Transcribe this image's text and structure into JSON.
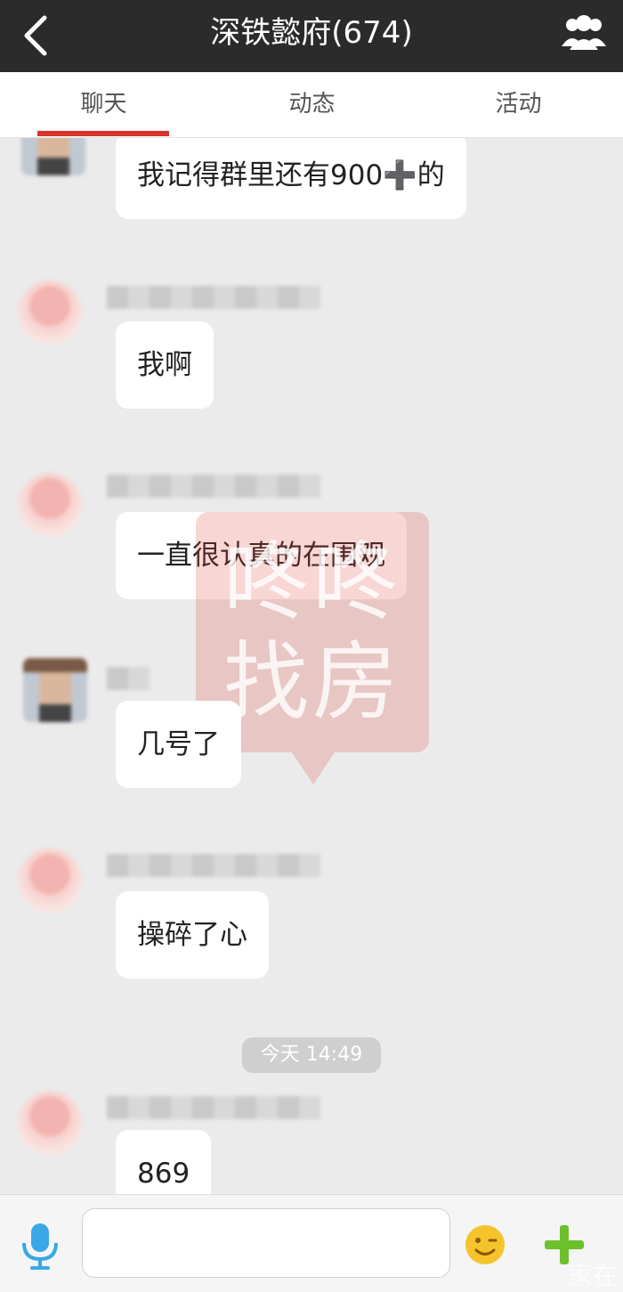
{
  "header": {
    "title": "深铁懿府(674)",
    "back_icon": "chevron-left-icon",
    "members_icon": "group-icon"
  },
  "tabs": [
    {
      "label": "聊天",
      "active": true
    },
    {
      "label": "动态",
      "active": false
    },
    {
      "label": "活动",
      "active": false
    }
  ],
  "messages": [
    {
      "text": "我记得群里还有900➕的"
    },
    {
      "text": "我啊"
    },
    {
      "text": "一直很认真的在围观"
    },
    {
      "text": "几号了"
    },
    {
      "text": "操碎了心"
    },
    {
      "text": "869"
    }
  ],
  "timestamp": "今天 14:49",
  "watermark": {
    "line1": "咚咚",
    "line2": "找房"
  },
  "input_bar": {
    "placeholder": "",
    "mic_icon": "microphone-icon",
    "emoji_icon": "smiley-icon",
    "plus_icon": "plus-icon",
    "corner_mark": "家在"
  },
  "colors": {
    "header_bg": "#2b2b2b",
    "tab_accent": "#d9342b",
    "chat_bg": "#ebebeb",
    "mic_blue": "#3aa7e6",
    "emoji_yellow": "#f5c42c",
    "plus_green": "#6cc02b"
  }
}
